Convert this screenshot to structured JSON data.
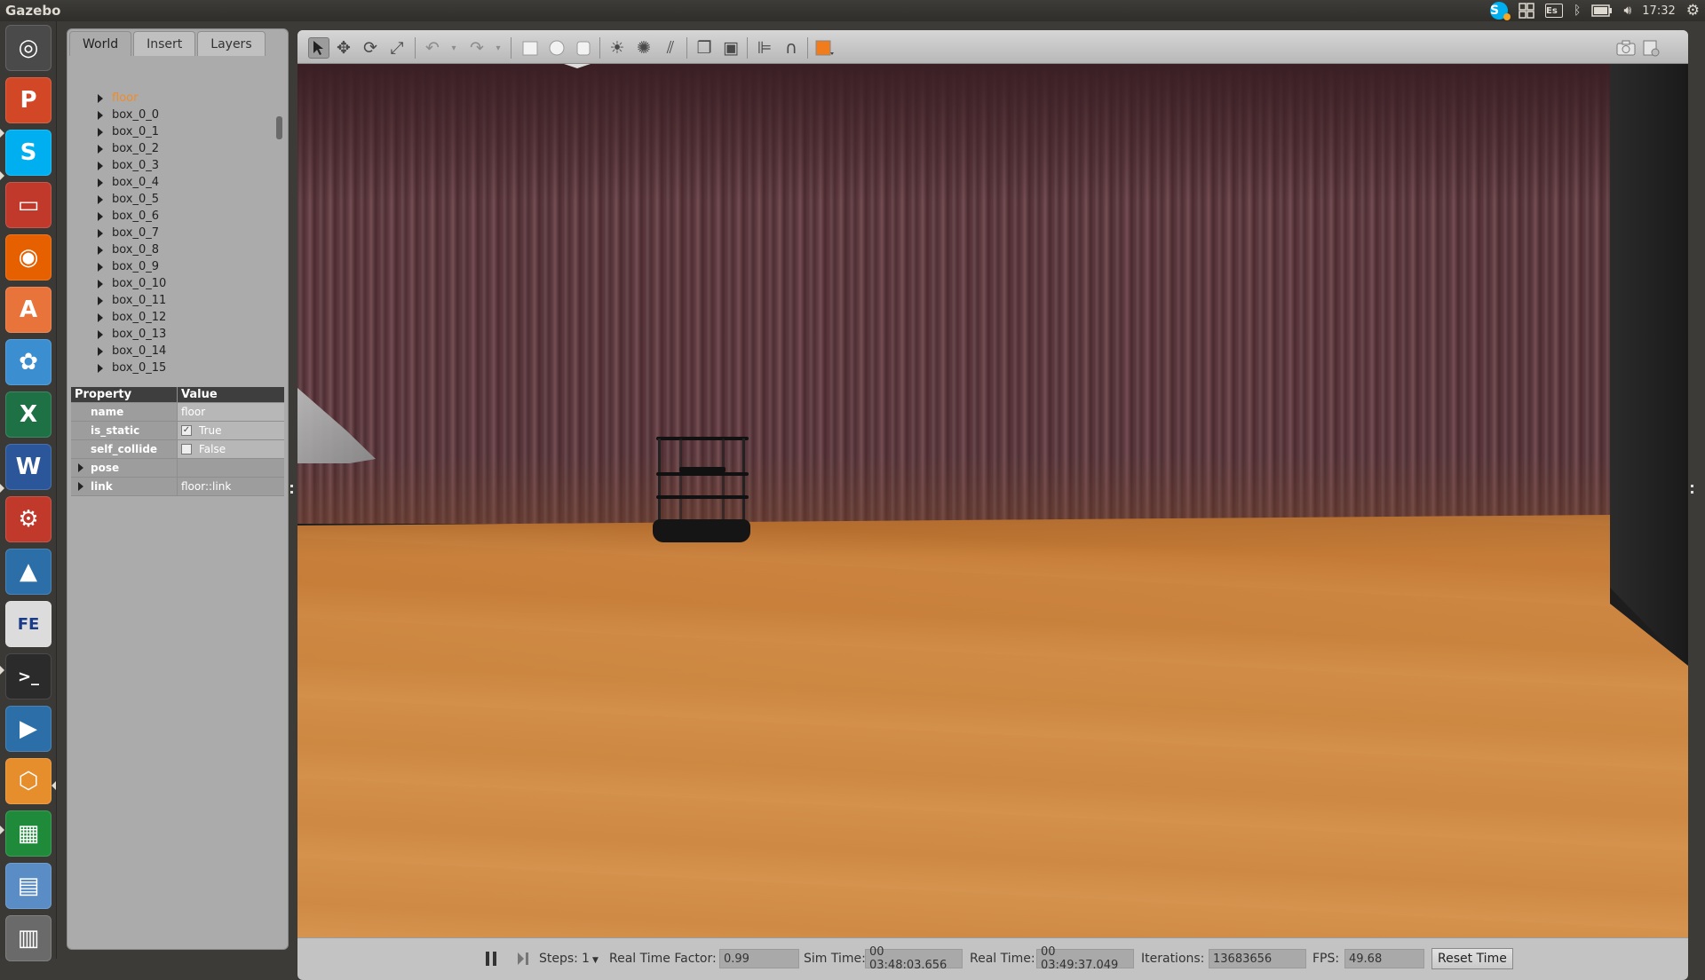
{
  "top_panel": {
    "app_title": "Gazebo",
    "keyboard_layout": "Es",
    "clock": "17:32",
    "skype_letter": "S"
  },
  "launcher": {
    "icons": [
      {
        "name": "ubuntu-dash-icon",
        "glyph": "◎",
        "color": "#4a4a4a"
      },
      {
        "name": "powerpoint-icon",
        "glyph": "P",
        "color": "#d24726"
      },
      {
        "name": "skype-icon",
        "glyph": "S",
        "color": "#00aff0"
      },
      {
        "name": "files-icon",
        "glyph": "▭",
        "color": "#c0392b"
      },
      {
        "name": "firefox-icon",
        "glyph": "◉",
        "color": "#e66000"
      },
      {
        "name": "software-center-icon",
        "glyph": "A",
        "color": "#e8743b"
      },
      {
        "name": "picasa-icon",
        "glyph": "✿",
        "color": "#3b8ed0"
      },
      {
        "name": "excel-icon",
        "glyph": "X",
        "color": "#1e7145"
      },
      {
        "name": "word-icon",
        "glyph": "W",
        "color": "#2b579a"
      },
      {
        "name": "system-settings-icon",
        "glyph": "⚙",
        "color": "#c0392b"
      },
      {
        "name": "matlab-icon",
        "glyph": "▲",
        "color": "#2c6ea8"
      },
      {
        "name": "fluid-sim-icon",
        "glyph": "FE",
        "color": "#dcdcdc"
      },
      {
        "name": "terminal-icon",
        "glyph": ">_",
        "color": "#2b2b2b"
      },
      {
        "name": "media-player-icon",
        "glyph": "▶",
        "color": "#2c6ea8"
      },
      {
        "name": "virtualbox-icon",
        "glyph": "⬡",
        "color": "#e58e2b"
      },
      {
        "name": "calc-icon",
        "glyph": "▦",
        "color": "#1e8a3a"
      },
      {
        "name": "presentation-icon",
        "glyph": "▤",
        "color": "#5a8dc5"
      },
      {
        "name": "trash-icon",
        "glyph": "▥",
        "color": "#6a6a6a"
      }
    ]
  },
  "tabs": [
    "World",
    "Insert",
    "Layers"
  ],
  "tree": {
    "selected": "floor",
    "items": [
      "box_0_0",
      "box_0_1",
      "box_0_2",
      "box_0_3",
      "box_0_4",
      "box_0_5",
      "box_0_6",
      "box_0_7",
      "box_0_8",
      "box_0_9",
      "box_0_10",
      "box_0_11",
      "box_0_12",
      "box_0_13",
      "box_0_14",
      "box_0_15"
    ]
  },
  "properties": {
    "header": {
      "property": "Property",
      "value": "Value"
    },
    "name": {
      "label": "name",
      "value": "floor"
    },
    "is_static": {
      "label": "is_static",
      "value": "True",
      "checked": true
    },
    "self_collide": {
      "label": "self_collide",
      "value": "False",
      "checked": false
    },
    "pose": {
      "label": "pose"
    },
    "link": {
      "label": "link",
      "value": "floor::link"
    }
  },
  "toolbar": {
    "tools": [
      "select-mode",
      "translate-mode",
      "rotate-mode",
      "scale-mode",
      "undo",
      "undo-history",
      "redo",
      "redo-history",
      "box-shape",
      "sphere-shape",
      "cylinder-shape",
      "point-light",
      "spot-light",
      "directional-light",
      "copy",
      "paste",
      "align",
      "snap",
      "view-angle"
    ]
  },
  "bottom_bar": {
    "steps_label": "Steps:",
    "steps_value": "1",
    "rtf_label": "Real Time Factor:",
    "rtf_value": "0.99",
    "sim_time_label": "Sim Time:",
    "sim_time_value": "00 03:48:03.656",
    "real_time_label": "Real Time:",
    "real_time_value": "00 03:49:37.049",
    "iterations_label": "Iterations:",
    "iterations_value": "13683656",
    "fps_label": "FPS:",
    "fps_value": "49.68",
    "reset_label": "Reset Time"
  },
  "colors": {
    "accent_selected": "#f08c28",
    "wall": "#5b383d",
    "floor": "#cf8a43"
  }
}
